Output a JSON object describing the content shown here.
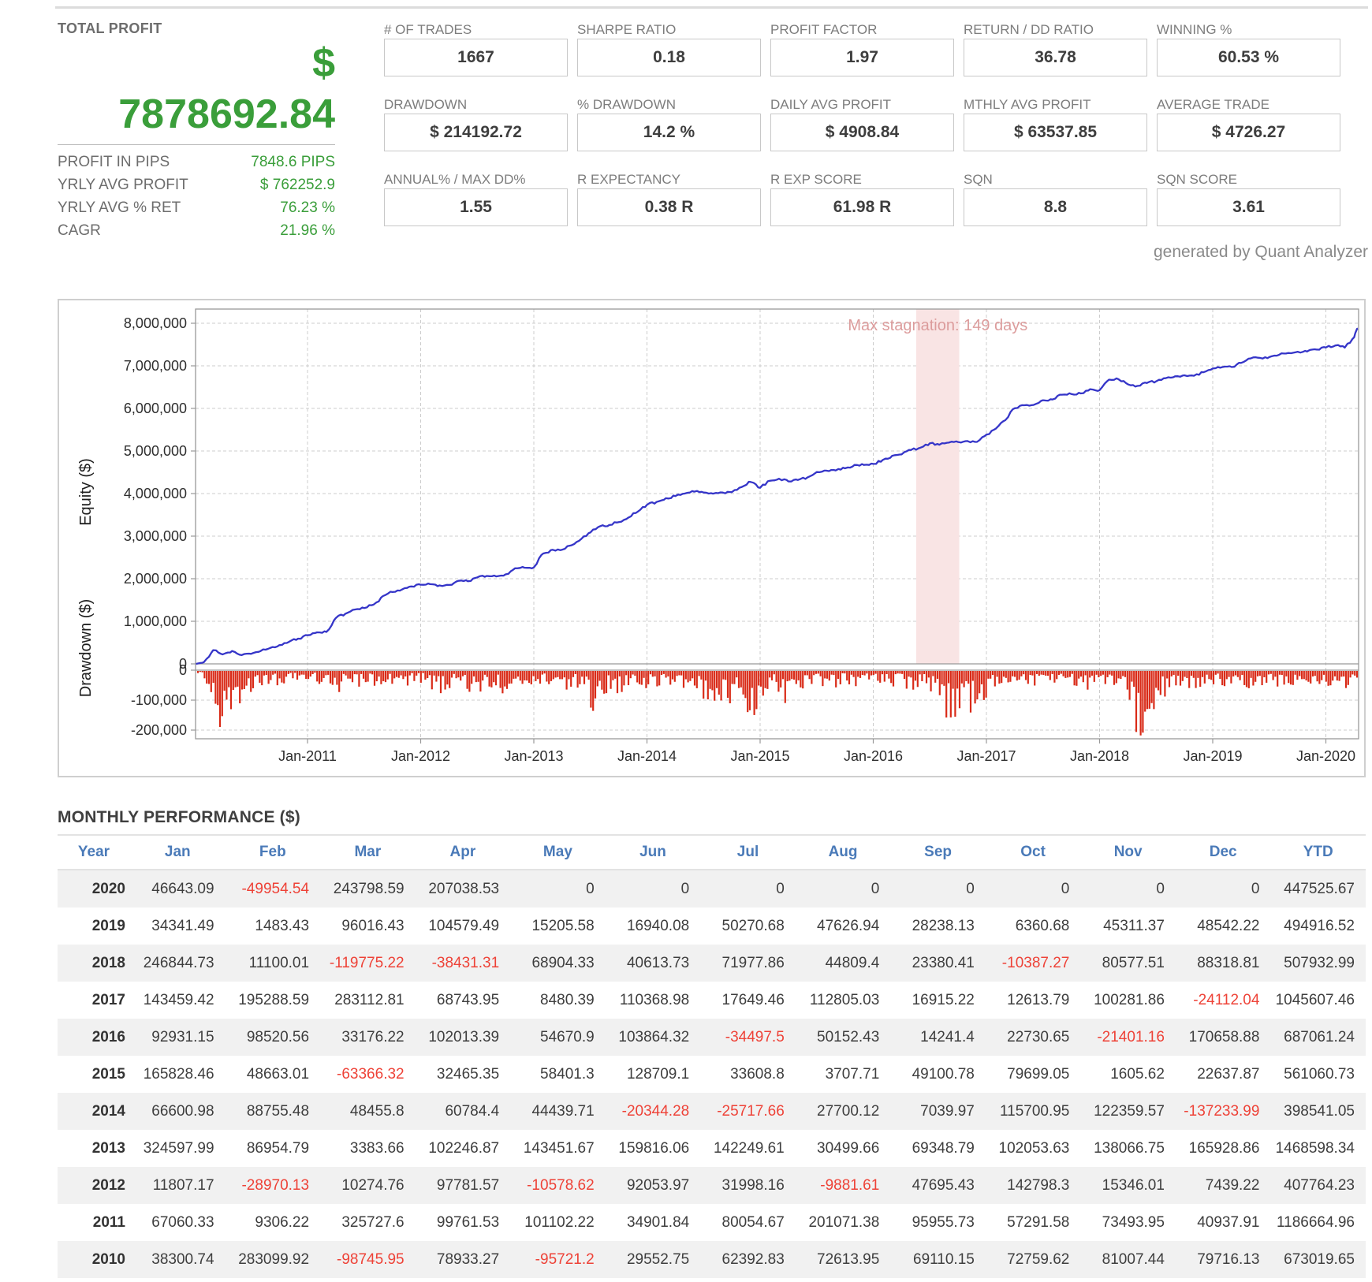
{
  "header": {
    "total_profit": {
      "label": "TOTAL PROFIT",
      "currency_symbol": "$",
      "value": "7878692.84",
      "rows": [
        {
          "label": "PROFIT IN PIPS",
          "value": "7848.6 PIPS"
        },
        {
          "label": "YRLY AVG PROFIT",
          "value": "$ 762252.9"
        },
        {
          "label": "YRLY AVG % RET",
          "value": "76.23 %"
        },
        {
          "label": "CAGR",
          "value": "21.96 %"
        }
      ]
    },
    "stats": [
      {
        "label": "# OF TRADES",
        "value": "1667"
      },
      {
        "label": "SHARPE RATIO",
        "value": "0.18"
      },
      {
        "label": "PROFIT FACTOR",
        "value": "1.97"
      },
      {
        "label": "RETURN / DD RATIO",
        "value": "36.78"
      },
      {
        "label": "WINNING %",
        "value": "60.53 %"
      },
      {
        "label": "DRAWDOWN",
        "value": "$ 214192.72"
      },
      {
        "label": "% DRAWDOWN",
        "value": "14.2 %"
      },
      {
        "label": "DAILY AVG PROFIT",
        "value": "$ 4908.84"
      },
      {
        "label": "MTHLY AVG PROFIT",
        "value": "$ 63537.85"
      },
      {
        "label": "AVERAGE TRADE",
        "value": "$ 4726.27"
      },
      {
        "label": "ANNUAL% / MAX DD%",
        "value": "1.55"
      },
      {
        "label": "R EXPECTANCY",
        "value": "0.38 R"
      },
      {
        "label": "R EXP SCORE",
        "value": "61.98 R"
      },
      {
        "label": "SQN",
        "value": "8.8"
      },
      {
        "label": "SQN SCORE",
        "value": "3.61"
      }
    ],
    "generated_by": "generated by Quant Analyzer"
  },
  "chart_data": {
    "type": "line",
    "title": "",
    "equity": {
      "ylabel": "Equity ($)",
      "ytick_values": [
        8000000,
        7000000,
        6000000,
        5000000,
        4000000,
        3000000,
        2000000,
        1000000,
        0
      ],
      "start_year": 2010,
      "points_per_month": 1,
      "cumulative_monthly": [
        38301,
        321401,
        222655,
        301588,
        205867,
        235420,
        297812,
        370426,
        439536,
        512296,
        593304,
        673020,
        740080,
        749386,
        1075114,
        1174875,
        1275978,
        1310879,
        1390934,
        1592005,
        1687961,
        1745253,
        1818747,
        1859685,
        1871492,
        1842522,
        1852796,
        1950578,
        1939999,
        2032053,
        2064051,
        2054170,
        2101865,
        2244664,
        2260010,
        2267449,
        2592047,
        2679002,
        2682385,
        2784632,
        2928084,
        3087900,
        3230149,
        3260649,
        3329998,
        3432052,
        3570118,
        3736047,
        3802648,
        3891404,
        3939859,
        4000644,
        4045084,
        4024739,
        3999022,
        4026722,
        4033762,
        4149463,
        4271822,
        4134588,
        4300417,
        4349080,
        4285713,
        4318179,
        4376580,
        4505289,
        4538898,
        4542606,
        4591706,
        4671405,
        4673011,
        4695649,
        4788580,
        4887101,
        4920277,
        5022290,
        5076961,
        5180826,
        5146328,
        5196480,
        5210722,
        5233452,
        5212051,
        5382710,
        5526170,
        5721458,
        6004571,
        6073315,
        6081795,
        6192164,
        6209814,
        6322619,
        6339534,
        6352148,
        6452430,
        6428318,
        6675162,
        6686262,
        6566487,
        6528056,
        6596960,
        6637574,
        6709552,
        6754361,
        6777742,
        6767354,
        6847932,
        6936251,
        6970592,
        6972076,
        7068092,
        7172671,
        7187877,
        7204817,
        7255088,
        7302715,
        7330953,
        7337314,
        7382625,
        7431167,
        7477810,
        7427856,
        7671654,
        7878693
      ]
    },
    "drawdown": {
      "ylabel": "Drawdown ($)",
      "ytick_values": [
        0,
        -100000,
        -200000
      ],
      "max_drawdown": 214192.72,
      "envelope": [
        [
          2010.04,
          15000
        ],
        [
          2010.1,
          45000
        ],
        [
          2010.16,
          80000
        ],
        [
          2010.22,
          185000
        ],
        [
          2010.28,
          225000
        ],
        [
          2010.33,
          150000
        ],
        [
          2010.38,
          195000
        ],
        [
          2010.45,
          90000
        ],
        [
          2010.55,
          55000
        ],
        [
          2010.65,
          45000
        ],
        [
          2010.75,
          55000
        ],
        [
          2010.85,
          35000
        ],
        [
          2010.95,
          45000
        ],
        [
          2011.05,
          35000
        ],
        [
          2011.15,
          55000
        ],
        [
          2011.25,
          85000
        ],
        [
          2011.35,
          45000
        ],
        [
          2011.45,
          65000
        ],
        [
          2011.55,
          35000
        ],
        [
          2011.65,
          75000
        ],
        [
          2011.75,
          45000
        ],
        [
          2011.85,
          60000
        ],
        [
          2011.95,
          35000
        ],
        [
          2012.05,
          50000
        ],
        [
          2012.15,
          85000
        ],
        [
          2012.25,
          60000
        ],
        [
          2012.35,
          55000
        ],
        [
          2012.45,
          95000
        ],
        [
          2012.55,
          65000
        ],
        [
          2012.65,
          55000
        ],
        [
          2012.75,
          85000
        ],
        [
          2012.85,
          70000
        ],
        [
          2012.92,
          115000
        ],
        [
          2012.97,
          90000
        ],
        [
          2013.05,
          55000
        ],
        [
          2013.15,
          45000
        ],
        [
          2013.25,
          85000
        ],
        [
          2013.35,
          60000
        ],
        [
          2013.45,
          55000
        ],
        [
          2013.52,
          145000
        ],
        [
          2013.58,
          95000
        ],
        [
          2013.68,
          65000
        ],
        [
          2013.78,
          85000
        ],
        [
          2013.88,
          55000
        ],
        [
          2013.95,
          60000
        ],
        [
          2014.05,
          60000
        ],
        [
          2014.15,
          45000
        ],
        [
          2014.25,
          70000
        ],
        [
          2014.35,
          55000
        ],
        [
          2014.45,
          85000
        ],
        [
          2014.52,
          115000
        ],
        [
          2014.58,
          170000
        ],
        [
          2014.65,
          140000
        ],
        [
          2014.72,
          120000
        ],
        [
          2014.8,
          65000
        ],
        [
          2014.88,
          140000
        ],
        [
          2014.95,
          150000
        ],
        [
          2015.05,
          65000
        ],
        [
          2015.12,
          55000
        ],
        [
          2015.18,
          125000
        ],
        [
          2015.24,
          150000
        ],
        [
          2015.32,
          100000
        ],
        [
          2015.42,
          65000
        ],
        [
          2015.52,
          50000
        ],
        [
          2015.62,
          70000
        ],
        [
          2015.72,
          45000
        ],
        [
          2015.82,
          60000
        ],
        [
          2015.92,
          50000
        ],
        [
          2016.02,
          45000
        ],
        [
          2016.12,
          60000
        ],
        [
          2016.22,
          50000
        ],
        [
          2016.32,
          70000
        ],
        [
          2016.42,
          55000
        ],
        [
          2016.5,
          65000
        ],
        [
          2016.56,
          105000
        ],
        [
          2016.62,
          145000
        ],
        [
          2016.7,
          185000
        ],
        [
          2016.76,
          125000
        ],
        [
          2016.82,
          165000
        ],
        [
          2016.88,
          135000
        ],
        [
          2016.94,
          175000
        ],
        [
          2017.0,
          130000
        ],
        [
          2017.06,
          65000
        ],
        [
          2017.12,
          50000
        ],
        [
          2017.22,
          40000
        ],
        [
          2017.32,
          60000
        ],
        [
          2017.42,
          50000
        ],
        [
          2017.52,
          70000
        ],
        [
          2017.62,
          50000
        ],
        [
          2017.72,
          60000
        ],
        [
          2017.82,
          50000
        ],
        [
          2017.92,
          70000
        ],
        [
          2018.02,
          50000
        ],
        [
          2018.12,
          60000
        ],
        [
          2018.2,
          85000
        ],
        [
          2018.27,
          130000
        ],
        [
          2018.32,
          205000
        ],
        [
          2018.37,
          220000
        ],
        [
          2018.42,
          175000
        ],
        [
          2018.47,
          135000
        ],
        [
          2018.55,
          95000
        ],
        [
          2018.65,
          70000
        ],
        [
          2018.75,
          90000
        ],
        [
          2018.85,
          60000
        ],
        [
          2018.95,
          50000
        ],
        [
          2019.05,
          45000
        ],
        [
          2019.15,
          60000
        ],
        [
          2019.25,
          55000
        ],
        [
          2019.32,
          105000
        ],
        [
          2019.38,
          80000
        ],
        [
          2019.45,
          60000
        ],
        [
          2019.55,
          50000
        ],
        [
          2019.65,
          70000
        ],
        [
          2019.75,
          50000
        ],
        [
          2019.85,
          60000
        ],
        [
          2019.95,
          45000
        ],
        [
          2020.05,
          55000
        ],
        [
          2020.12,
          75000
        ],
        [
          2020.17,
          95000
        ],
        [
          2020.23,
          60000
        ],
        [
          2020.28,
          45000
        ],
        [
          2020.33,
          30000
        ]
      ]
    },
    "xticks": [
      "Jan-2011",
      "Jan-2012",
      "Jan-2013",
      "Jan-2014",
      "Jan-2015",
      "Jan-2016",
      "Jan-2017",
      "Jan-2018",
      "Jan-2019",
      "Jan-2020"
    ],
    "annotation": {
      "text": "Max stagnation: 149 days",
      "band_start": 2016.38,
      "band_end": 2016.76
    },
    "grid": true,
    "colors": {
      "equity_line": "#3535c8",
      "drawdown_fill": "#d92a17",
      "stagnation_band": "#f9e4e4",
      "annotation_text": "#dc9c9c",
      "gridline": "#cccccc",
      "axis": "#999999",
      "tick_text": "#2e2e2e"
    }
  },
  "monthly_performance": {
    "title": "MONTHLY PERFORMANCE ($)",
    "columns": [
      "Year",
      "Jan",
      "Feb",
      "Mar",
      "Apr",
      "May",
      "Jun",
      "Jul",
      "Aug",
      "Sep",
      "Oct",
      "Nov",
      "Dec",
      "YTD"
    ],
    "rows": [
      {
        "year": "2020",
        "values": [
          "46643.09",
          "-49954.54",
          "243798.59",
          "207038.53",
          "0",
          "0",
          "0",
          "0",
          "0",
          "0",
          "0",
          "0",
          "447525.67"
        ]
      },
      {
        "year": "2019",
        "values": [
          "34341.49",
          "1483.43",
          "96016.43",
          "104579.49",
          "15205.58",
          "16940.08",
          "50270.68",
          "47626.94",
          "28238.13",
          "6360.68",
          "45311.37",
          "48542.22",
          "494916.52"
        ]
      },
      {
        "year": "2018",
        "values": [
          "246844.73",
          "11100.01",
          "-119775.22",
          "-38431.31",
          "68904.33",
          "40613.73",
          "71977.86",
          "44809.4",
          "23380.41",
          "-10387.27",
          "80577.51",
          "88318.81",
          "507932.99"
        ]
      },
      {
        "year": "2017",
        "values": [
          "143459.42",
          "195288.59",
          "283112.81",
          "68743.95",
          "8480.39",
          "110368.98",
          "17649.46",
          "112805.03",
          "16915.22",
          "12613.79",
          "100281.86",
          "-24112.04",
          "1045607.46"
        ]
      },
      {
        "year": "2016",
        "values": [
          "92931.15",
          "98520.56",
          "33176.22",
          "102013.39",
          "54670.9",
          "103864.32",
          "-34497.5",
          "50152.43",
          "14241.4",
          "22730.65",
          "-21401.16",
          "170658.88",
          "687061.24"
        ]
      },
      {
        "year": "2015",
        "values": [
          "165828.46",
          "48663.01",
          "-63366.32",
          "32465.35",
          "58401.3",
          "128709.1",
          "33608.8",
          "3707.71",
          "49100.78",
          "79699.05",
          "1605.62",
          "22637.87",
          "561060.73"
        ]
      },
      {
        "year": "2014",
        "values": [
          "66600.98",
          "88755.48",
          "48455.8",
          "60784.4",
          "44439.71",
          "-20344.28",
          "-25717.66",
          "27700.12",
          "7039.97",
          "115700.95",
          "122359.57",
          "-137233.99",
          "398541.05"
        ]
      },
      {
        "year": "2013",
        "values": [
          "324597.99",
          "86954.79",
          "3383.66",
          "102246.87",
          "143451.67",
          "159816.06",
          "142249.61",
          "30499.66",
          "69348.79",
          "102053.63",
          "138066.75",
          "165928.86",
          "1468598.34"
        ]
      },
      {
        "year": "2012",
        "values": [
          "11807.17",
          "-28970.13",
          "10274.76",
          "97781.57",
          "-10578.62",
          "92053.97",
          "31998.16",
          "-9881.61",
          "47695.43",
          "142798.3",
          "15346.01",
          "7439.22",
          "407764.23"
        ]
      },
      {
        "year": "2011",
        "values": [
          "67060.33",
          "9306.22",
          "325727.6",
          "99761.53",
          "101102.22",
          "34901.84",
          "80054.67",
          "201071.38",
          "95955.73",
          "57291.58",
          "73493.95",
          "40937.91",
          "1186664.96"
        ]
      },
      {
        "year": "2010",
        "values": [
          "38300.74",
          "283099.92",
          "-98745.95",
          "78933.27",
          "-95721.2",
          "29552.75",
          "62392.83",
          "72613.95",
          "69110.15",
          "72759.62",
          "81007.44",
          "79716.13",
          "673019.65"
        ]
      }
    ]
  },
  "colors": {
    "profit_green": "#3a9e3a",
    "negative_red": "#ee4237",
    "table_header_blue": "#4a7ab8",
    "label_gray": "#6d6d6d",
    "value_dark": "#3e3e3e"
  }
}
